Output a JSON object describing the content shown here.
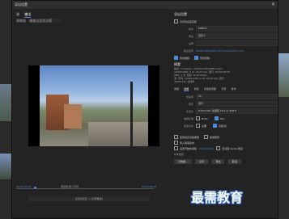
{
  "window": {
    "title": "导出设置"
  },
  "left": {
    "tabs": [
      "源",
      "输出"
    ],
    "source_scaling_label": "源缩放",
    "source_scaling_value": "缩放以适合边框",
    "timecode_in": "00;00;00;00",
    "timecode_out": "00;00;08;06",
    "source_range_label": "源范围",
    "source_range_value": "整个序列",
    "aspect_bar": "宽高比校正: 1 (方形像素)"
  },
  "right": {
    "export_settings_header": "导出设置",
    "match_sequence_label": "与序列设置匹配",
    "format_label": "格式",
    "format_value": "MPEG4",
    "preset_label": "预设",
    "preset_value": "自定义",
    "comments_label": "注释",
    "output_name_label": "输出名称",
    "output_name_value": "00d09-0000-BMC-XT5VideoXXXXX.mp4",
    "export_video_label": "导出视频",
    "export_audio_label": "导出音频",
    "summary_header": "摘要",
    "summary_lines": [
      "输出: C:\\Users\\...\\00d09-0000-BMC.mp4",
      "1920x1080 (1.0), 29.97 fps, 逐行, 00:00:08:06",
      "VBR, 1 次, 目标 10.00 Mbps",
      "源: 序列, 1920x1080 (1.0), 29.97 fps, 逐行",
      "48000 Hz, 立体声"
    ],
    "tabs": [
      "效果",
      "视频",
      "音频",
      "多路复用器",
      "字幕",
      "发布"
    ],
    "video_section": {
      "frame_rate_label": "帧速率",
      "frame_rate_value": "25",
      "field_order_label": "场序",
      "field_order_value": "逐行",
      "aspect_label": "长宽比",
      "aspect_value": "D1/DV PAL 宽银幕 16:9 (1.4587)",
      "tv_standard_label": "电视标准",
      "ntsc": "NTSC",
      "pal": "PAL",
      "render_label": "配置文件",
      "render_option_a": "主要",
      "render_option_b": "高级/高"
    },
    "options": [
      "使用最高渲染质量",
      "使用预览",
      "导入到项目中",
      "设置开始时间码",
      "仅渲染 Alpha 通道",
      "时间插值"
    ],
    "timecode_value": "00;00;00;00",
    "buttons": [
      "元数据...",
      "队列",
      "导出",
      "取消"
    ]
  },
  "watermark": "最需教育"
}
